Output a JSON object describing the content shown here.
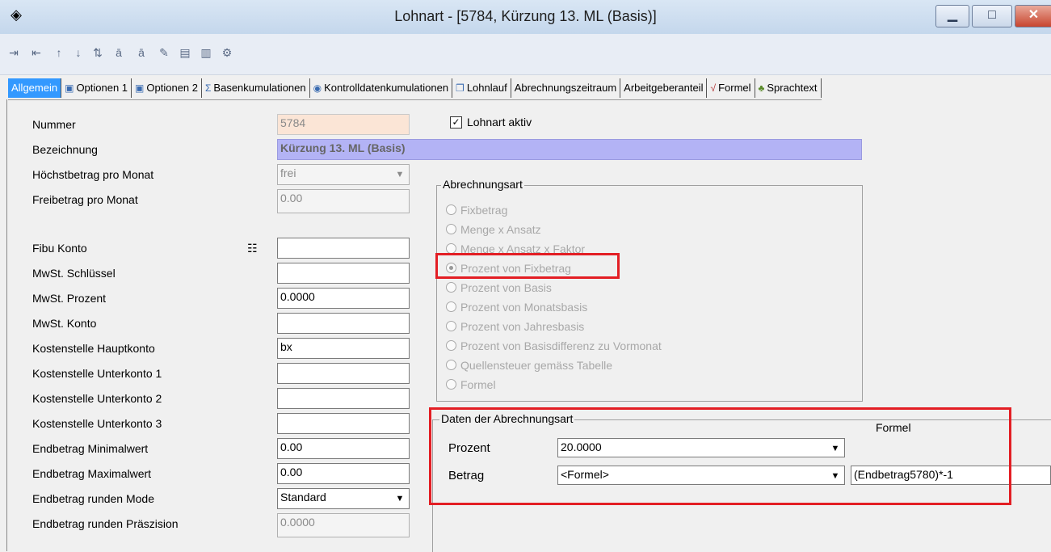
{
  "window": {
    "title": "Lohnart - [5784, Kürzung 13. ML (Basis)]",
    "min_icon": "minimize-icon",
    "max_icon": "maximize-icon",
    "close_icon": "close-icon"
  },
  "toolbar": {
    "icons": [
      "insert-row-icon",
      "delete-row-icon",
      "move-up-icon",
      "move-down-icon",
      "sort-az-icon",
      "spellcheck-icon",
      "spellcheck-alt-icon",
      "edit-icon",
      "list-icon",
      "list-alt-icon",
      "settings-icon"
    ]
  },
  "tabs": [
    {
      "label": "Allgemein",
      "active": true
    },
    {
      "label": "Optionen 1"
    },
    {
      "label": "Optionen 2"
    },
    {
      "label": "Basenkumulationen"
    },
    {
      "label": "Kontrolldatenkumulationen"
    },
    {
      "label": "Lohnlauf"
    },
    {
      "label": "Abrechnungszeitraum"
    },
    {
      "label": "Arbeitgeberanteil"
    },
    {
      "label": "Formel"
    },
    {
      "label": "Sprachtext"
    }
  ],
  "form": {
    "nummer": {
      "label": "Nummer",
      "value": "5784"
    },
    "bezeichnung": {
      "label": "Bezeichnung",
      "value": "Kürzung 13. ML (Basis)"
    },
    "hoechstbetrag": {
      "label": "Höchstbetrag pro Monat",
      "value": "frei"
    },
    "freibetrag": {
      "label": "Freibetrag pro Monat",
      "value": "0.00"
    },
    "fibu": {
      "label": "Fibu Konto",
      "value": ""
    },
    "mwst_schluessel": {
      "label": "MwSt. Schlüssel",
      "value": ""
    },
    "mwst_prozent": {
      "label": "MwSt. Prozent",
      "value": "0.0000"
    },
    "mwst_konto": {
      "label": "MwSt. Konto",
      "value": ""
    },
    "ks_haupt": {
      "label": "Kostenstelle Hauptkonto",
      "value": "bx"
    },
    "ks_unter1": {
      "label": "Kostenstelle Unterkonto 1",
      "value": ""
    },
    "ks_unter2": {
      "label": "Kostenstelle Unterkonto 2",
      "value": ""
    },
    "ks_unter3": {
      "label": "Kostenstelle Unterkonto 3",
      "value": ""
    },
    "end_min": {
      "label": "Endbetrag Minimalwert",
      "value": "0.00"
    },
    "end_max": {
      "label": "Endbetrag Maximalwert",
      "value": "0.00"
    },
    "end_mode": {
      "label": "Endbetrag runden Mode",
      "value": "Standard"
    },
    "end_praez": {
      "label": "Endbetrag runden Präszision",
      "value": "0.0000"
    }
  },
  "lohnart_aktiv": {
    "label": "Lohnart aktiv",
    "checked": true
  },
  "abrechnungsart": {
    "title": "Abrechnungsart",
    "options": [
      "Fixbetrag",
      "Menge x Ansatz",
      "Menge x Ansatz x Faktor",
      "Prozent von Fixbetrag",
      "Prozent von Basis",
      "Prozent von Monatsbasis",
      "Prozent von Jahresbasis",
      "Prozent von Basisdifferenz zu Vormonat",
      "Quellensteuer gemäss Tabelle",
      "Formel"
    ],
    "selected": "Prozent von Fixbetrag"
  },
  "daten": {
    "title": "Daten der Abrechnungsart",
    "formel_label": "Formel",
    "prozent": {
      "label": "Prozent",
      "value": "20.0000"
    },
    "betrag": {
      "label": "Betrag",
      "value": "<Formel>"
    },
    "formel_value": "(Endbetrag5780)*-1"
  },
  "colors": {
    "highlight": "#e31e24",
    "active_tab": "#3399ff",
    "desc_bg": "#b3b3f5",
    "num_bg": "#fbe5d6"
  }
}
